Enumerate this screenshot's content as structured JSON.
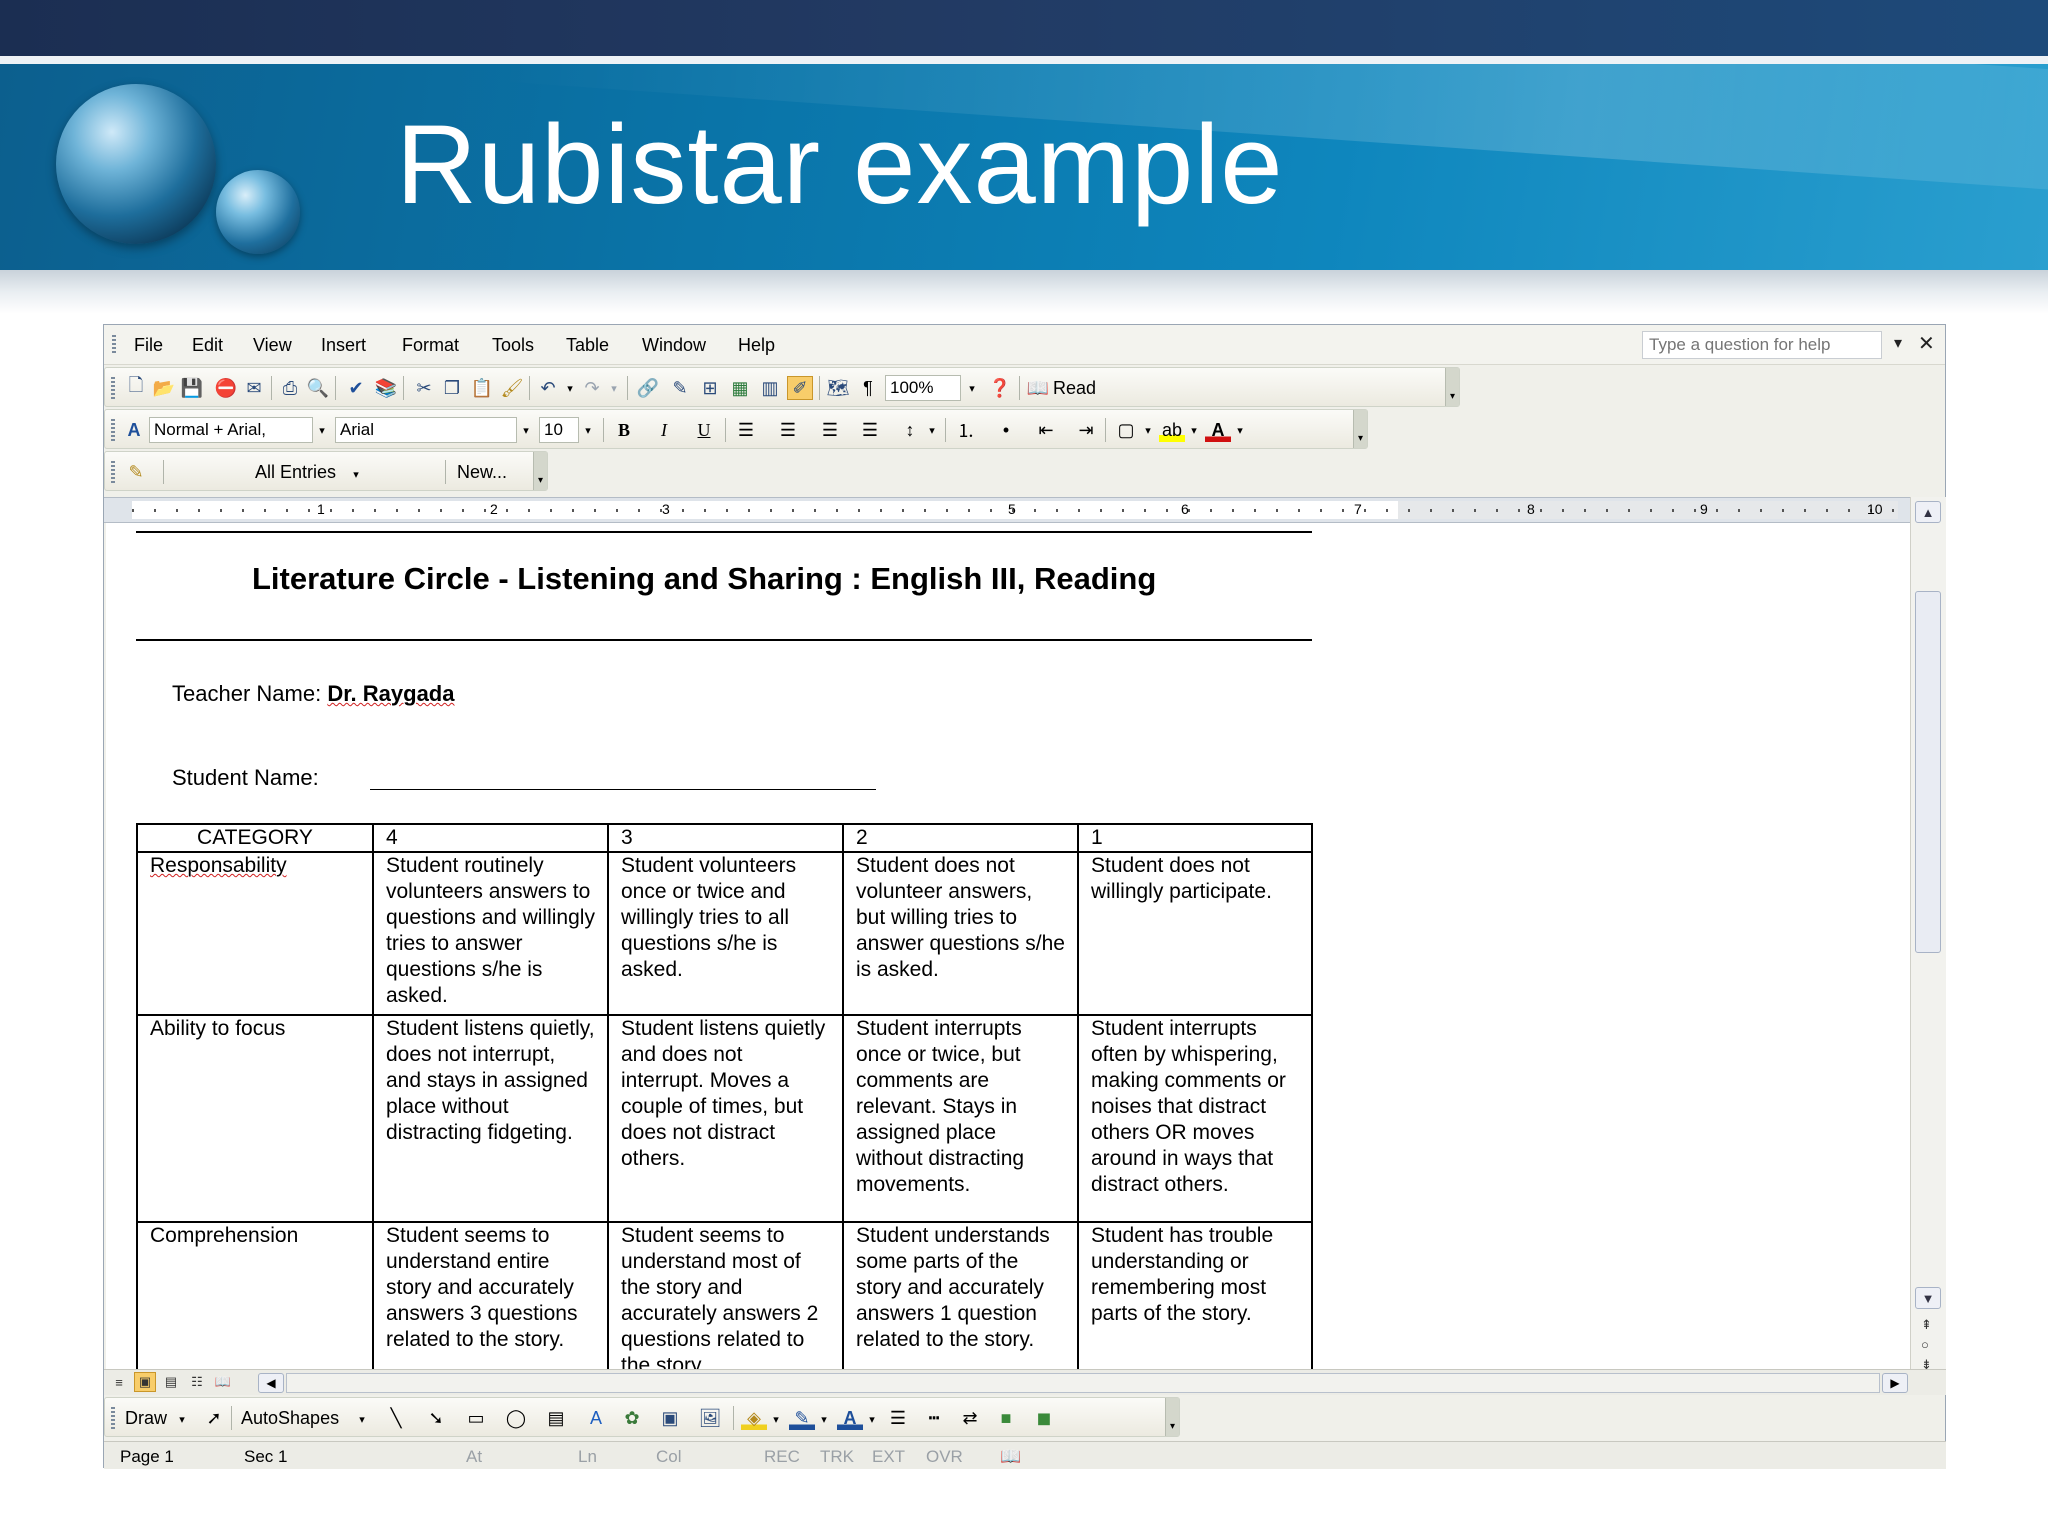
{
  "slide": {
    "title": "Rubistar example"
  },
  "word": {
    "menu": [
      "File",
      "Edit",
      "View",
      "Insert",
      "Format",
      "Tools",
      "Table",
      "Window",
      "Help"
    ],
    "help_placeholder": "Type a question for help",
    "zoom": "100%",
    "read_label": "Read",
    "style": "Normal + Arial,",
    "font": "Arial",
    "font_size": "10",
    "review_entries": "All Entries",
    "review_new": "New...",
    "ruler_numbers": [
      "1",
      "2",
      "3",
      "5",
      "6",
      "7",
      "8",
      "9",
      "10"
    ],
    "draw_label": "Draw",
    "autoshapes_label": "AutoShapes",
    "status": {
      "page": "Page 1",
      "sec": "Sec 1",
      "at": "At",
      "ln": "Ln",
      "col": "Col",
      "rec": "REC",
      "trk": "TRK",
      "ext": "EXT",
      "ovr": "OVR"
    }
  },
  "document": {
    "title": "Literature Circle - Listening and Sharing : English III, Reading",
    "teacher_label": "Teacher Name:",
    "teacher_name": "Dr. Raygada",
    "student_label": "Student Name:",
    "table": {
      "headers": [
        "CATEGORY",
        "4",
        "3",
        "2",
        "1"
      ],
      "rows": [
        {
          "category": "Responsability",
          "cells": [
            "Student routinely volunteers answers to questions and willingly tries to answer questions s/he is asked.",
            "Student volunteers once or twice and willingly tries to all questions s/he is asked.",
            "Student does not volunteer answers, but willing tries to answer questions s/he is asked.",
            "Student does not willingly participate."
          ]
        },
        {
          "category": "Ability to focus",
          "cells": [
            "Student listens quietly, does not interrupt, and stays in assigned place without distracting fidgeting.",
            "Student listens quietly and does not interrupt. Moves a couple of times, but does not distract others.",
            "Student interrupts once or twice, but comments are relevant. Stays in assigned place without distracting movements.",
            "Student interrupts often by whispering, making comments or noises that distract others OR moves around in ways that distract others."
          ]
        },
        {
          "category": "Comprehension",
          "cells": [
            "Student seems to understand entire story and accurately answers 3 questions related to the story.",
            "Student seems to understand most of the story and accurately answers 2 questions related to the story.",
            "Student understands some parts of the story and accurately answers 1 question related to the story.",
            "Student has trouble understanding or remembering most parts of the story."
          ]
        }
      ]
    }
  }
}
